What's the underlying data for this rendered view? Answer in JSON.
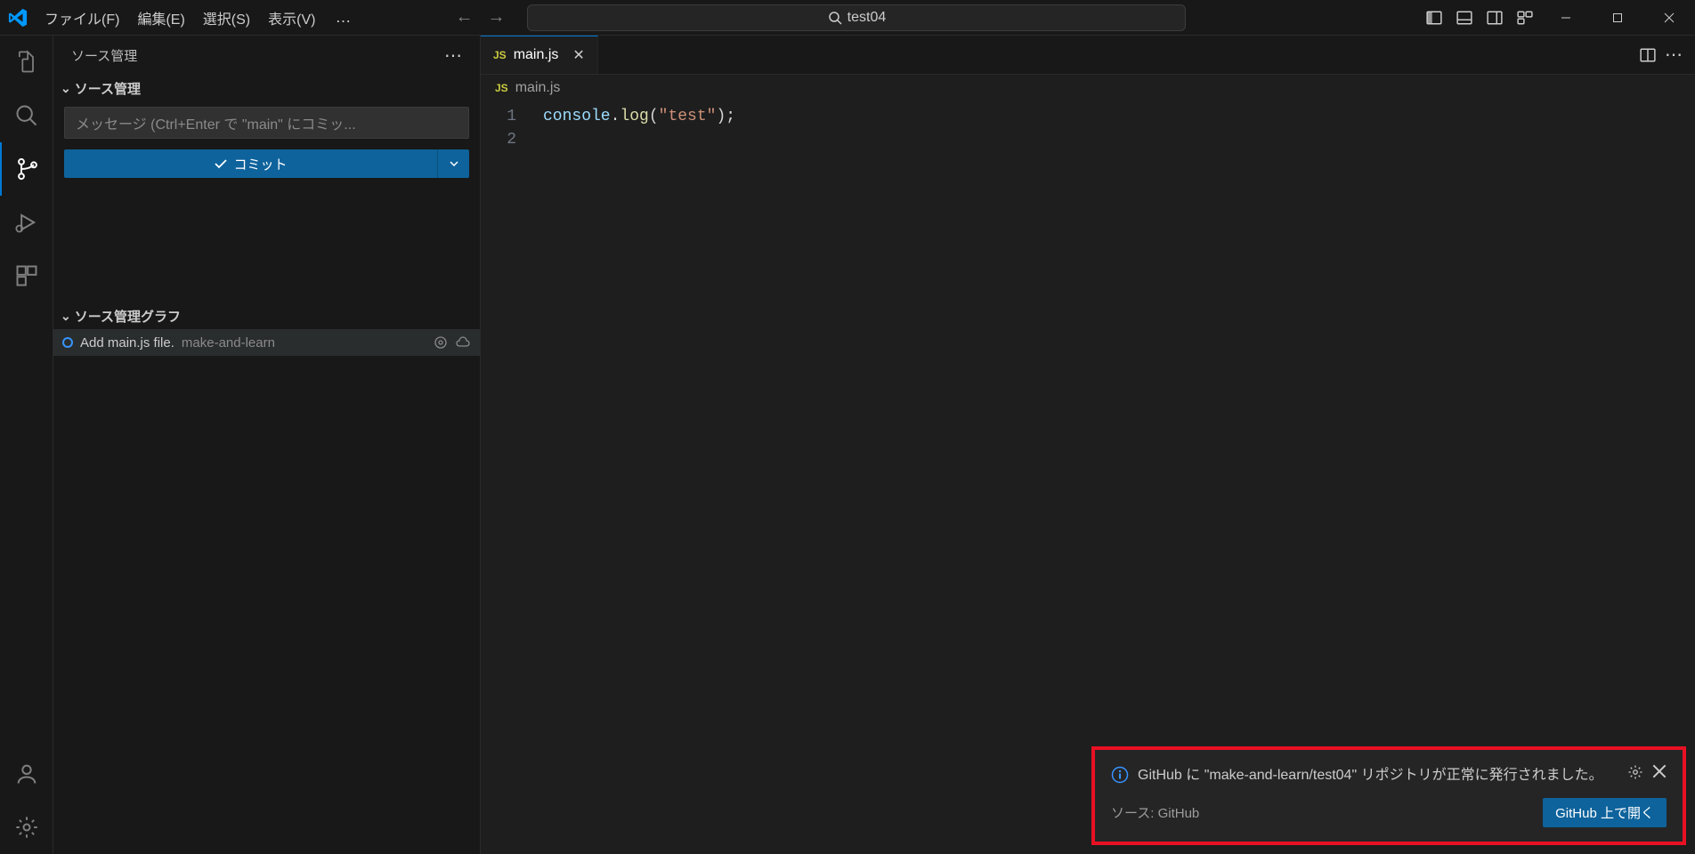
{
  "menubar": {
    "file": "ファイル(F)",
    "edit": "編集(E)",
    "selection": "選択(S)",
    "view": "表示(V)",
    "ellipsis": "…"
  },
  "search": {
    "text": "test04"
  },
  "sidebar": {
    "title": "ソース管理",
    "section_title": "ソース管理",
    "commit_placeholder": "メッセージ (Ctrl+Enter で \"main\" にコミッ...",
    "commit_button": "コミット",
    "graph_title": "ソース管理グラフ",
    "graph_item": {
      "message": "Add main.js file.",
      "author": "make-and-learn"
    }
  },
  "tab": {
    "filename": "main.js",
    "js_badge": "JS"
  },
  "breadcrumb": {
    "filename": "main.js",
    "js_badge": "JS"
  },
  "code": {
    "line1_obj": "console",
    "line1_dot": ".",
    "line1_fn": "log",
    "line1_open": "(",
    "line1_str": "\"test\"",
    "line1_close": ")",
    "line1_semi": ";",
    "gutter": [
      "1",
      "2"
    ]
  },
  "notification": {
    "message": "GitHub に \"make-and-learn/test04\" リポジトリが正常に発行されました。",
    "source": "ソース: GitHub",
    "button": "GitHub 上で開く"
  }
}
